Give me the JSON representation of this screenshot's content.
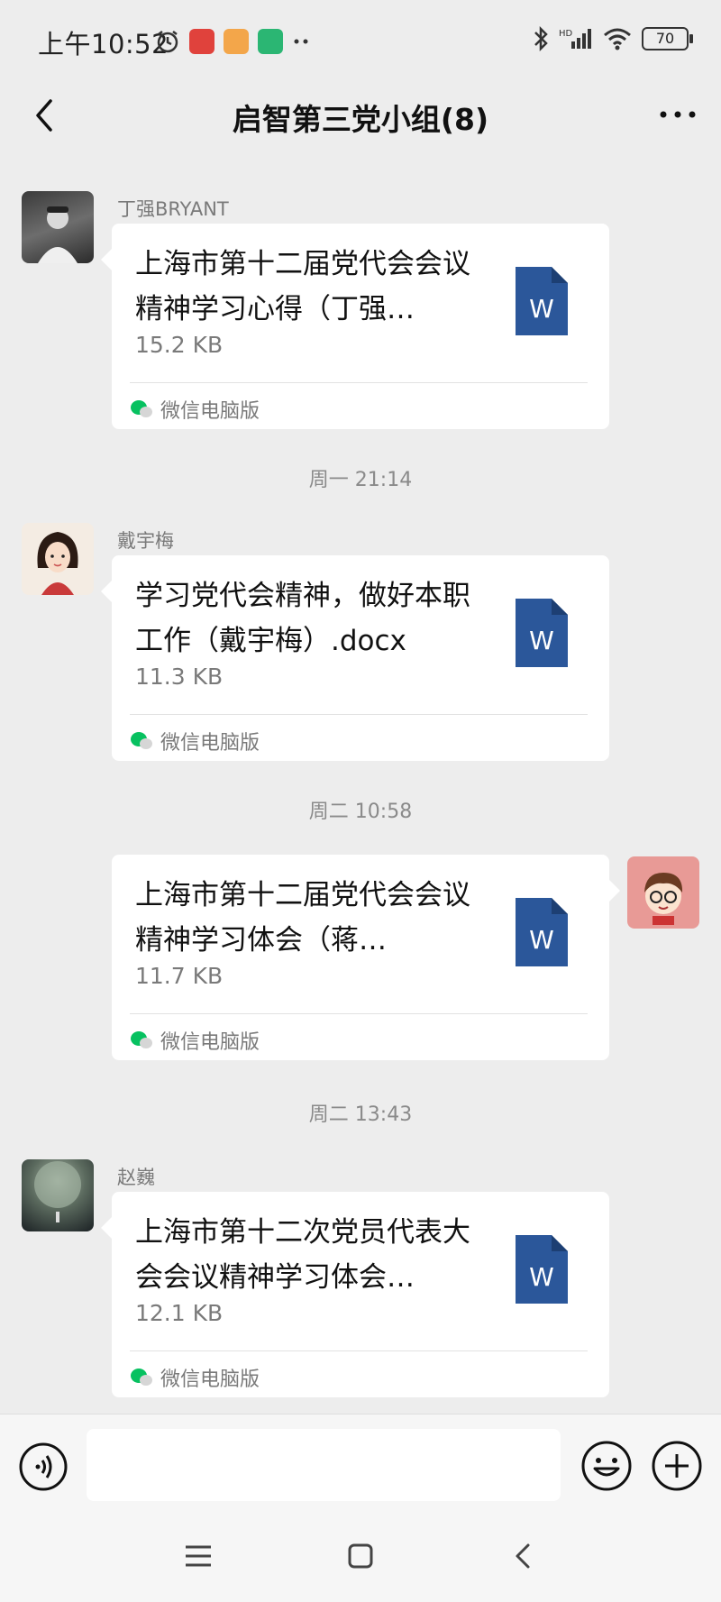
{
  "status_bar": {
    "time": "上午10:52",
    "battery": "70",
    "icons_left": [
      "alarm-icon",
      "app-icon-red",
      "app-icon-orange",
      "home-app-icon",
      "more-dots-icon"
    ],
    "icons_right": [
      "bluetooth-icon",
      "signal-icon",
      "wifi-icon",
      "battery-icon"
    ]
  },
  "header": {
    "title": "启智第三党小组(8)",
    "back_icon": "chevron-left-icon",
    "more_icon": "more-horizontal-icon"
  },
  "chat": {
    "timestamps": [
      "周一 21:14",
      "周二 10:58",
      "周二 13:43"
    ],
    "messages": [
      {
        "sender": "丁强BRYANT",
        "side": "left",
        "file_name": "上海市第十二届党代会会议精神学习心得（丁强…",
        "file_size": "15.2 KB",
        "footer": "微信电脑版"
      },
      {
        "sender": "戴宇梅",
        "side": "left",
        "file_name": "学习党代会精神，做好本职工作（戴宇梅）.docx",
        "file_size": "11.3 KB",
        "footer": "微信电脑版"
      },
      {
        "sender": "",
        "side": "right",
        "file_name": "上海市第十二届党代会会议精神学习体会（蒋…",
        "file_size": "11.7 KB",
        "footer": "微信电脑版"
      },
      {
        "sender": "赵巍",
        "side": "left",
        "file_name": "上海市第十二次党员代表大会会议精神学习体会…",
        "file_size": "12.1 KB",
        "footer": "微信电脑版"
      }
    ]
  },
  "input_bar": {
    "placeholder": "",
    "voice_icon": "voice-icon",
    "emoji_icon": "emoji-icon",
    "plus_icon": "plus-icon"
  },
  "system_nav": {
    "icons": [
      "menu-icon",
      "home-icon",
      "back-icon"
    ]
  },
  "colors": {
    "background": "#ededed",
    "bubble": "#ffffff",
    "word_blue": "#2b579a",
    "muted_text": "#8a8a8a",
    "wechat_green": "#07c160"
  }
}
